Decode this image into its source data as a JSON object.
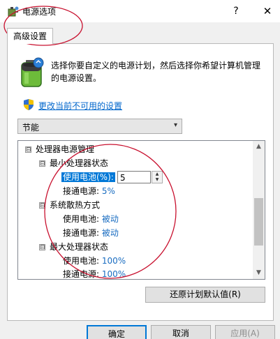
{
  "window": {
    "title": "电源选项",
    "help_glyph": "?",
    "close_glyph": "✕"
  },
  "tab": {
    "label": "高级设置"
  },
  "description": "选择你要自定义的电源计划，然后选择你希望计算机管理的电源设置。",
  "change_link": "更改当前不可用的设置",
  "plan_select": {
    "value": "节能",
    "arrow": "▾"
  },
  "tree": {
    "root": {
      "expander": "⊟",
      "label": "处理器电源管理"
    },
    "min_state": {
      "expander": "⊟",
      "label": "最小处理器状态",
      "battery_label": "使用电池(%):",
      "battery_value": "5",
      "plugged_label": "接通电源:",
      "plugged_value": "5%"
    },
    "cooling": {
      "expander": "⊟",
      "label": "系统散热方式",
      "battery_label": "使用电池:",
      "battery_value": "被动",
      "plugged_label": "接通电源:",
      "plugged_value": "被动"
    },
    "max_state": {
      "expander": "⊟",
      "label": "最大处理器状态",
      "battery_label": "使用电池:",
      "battery_value": "100%",
      "plugged_label": "接通电源:",
      "plugged_value": "100%"
    }
  },
  "restore_button": "还原计划默认值(R)",
  "buttons": {
    "ok": "确定",
    "cancel": "取消",
    "apply": "应用(A)"
  },
  "annotation_color": "#c8102e"
}
